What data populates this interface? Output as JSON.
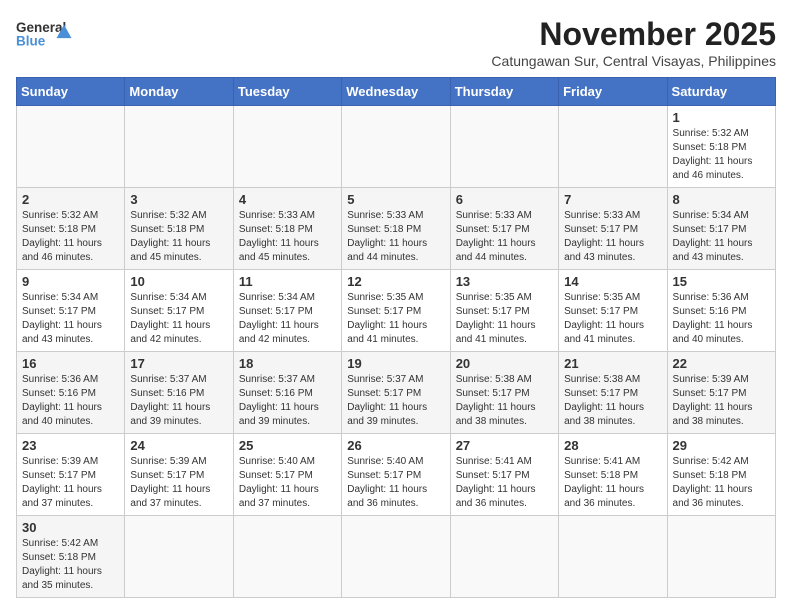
{
  "logo": {
    "general": "General",
    "blue": "Blue"
  },
  "header": {
    "month": "November 2025",
    "location": "Catungawan Sur, Central Visayas, Philippines"
  },
  "weekdays": [
    "Sunday",
    "Monday",
    "Tuesday",
    "Wednesday",
    "Thursday",
    "Friday",
    "Saturday"
  ],
  "weeks": [
    [
      {
        "day": "",
        "sunrise": "",
        "sunset": "",
        "daylight": ""
      },
      {
        "day": "",
        "sunrise": "",
        "sunset": "",
        "daylight": ""
      },
      {
        "day": "",
        "sunrise": "",
        "sunset": "",
        "daylight": ""
      },
      {
        "day": "",
        "sunrise": "",
        "sunset": "",
        "daylight": ""
      },
      {
        "day": "",
        "sunrise": "",
        "sunset": "",
        "daylight": ""
      },
      {
        "day": "",
        "sunrise": "",
        "sunset": "",
        "daylight": ""
      },
      {
        "day": "1",
        "sunrise": "Sunrise: 5:32 AM",
        "sunset": "Sunset: 5:18 PM",
        "daylight": "Daylight: 11 hours and 46 minutes."
      }
    ],
    [
      {
        "day": "2",
        "sunrise": "Sunrise: 5:32 AM",
        "sunset": "Sunset: 5:18 PM",
        "daylight": "Daylight: 11 hours and 46 minutes."
      },
      {
        "day": "3",
        "sunrise": "Sunrise: 5:32 AM",
        "sunset": "Sunset: 5:18 PM",
        "daylight": "Daylight: 11 hours and 45 minutes."
      },
      {
        "day": "4",
        "sunrise": "Sunrise: 5:33 AM",
        "sunset": "Sunset: 5:18 PM",
        "daylight": "Daylight: 11 hours and 45 minutes."
      },
      {
        "day": "5",
        "sunrise": "Sunrise: 5:33 AM",
        "sunset": "Sunset: 5:18 PM",
        "daylight": "Daylight: 11 hours and 44 minutes."
      },
      {
        "day": "6",
        "sunrise": "Sunrise: 5:33 AM",
        "sunset": "Sunset: 5:17 PM",
        "daylight": "Daylight: 11 hours and 44 minutes."
      },
      {
        "day": "7",
        "sunrise": "Sunrise: 5:33 AM",
        "sunset": "Sunset: 5:17 PM",
        "daylight": "Daylight: 11 hours and 43 minutes."
      },
      {
        "day": "8",
        "sunrise": "Sunrise: 5:34 AM",
        "sunset": "Sunset: 5:17 PM",
        "daylight": "Daylight: 11 hours and 43 minutes."
      }
    ],
    [
      {
        "day": "9",
        "sunrise": "Sunrise: 5:34 AM",
        "sunset": "Sunset: 5:17 PM",
        "daylight": "Daylight: 11 hours and 43 minutes."
      },
      {
        "day": "10",
        "sunrise": "Sunrise: 5:34 AM",
        "sunset": "Sunset: 5:17 PM",
        "daylight": "Daylight: 11 hours and 42 minutes."
      },
      {
        "day": "11",
        "sunrise": "Sunrise: 5:34 AM",
        "sunset": "Sunset: 5:17 PM",
        "daylight": "Daylight: 11 hours and 42 minutes."
      },
      {
        "day": "12",
        "sunrise": "Sunrise: 5:35 AM",
        "sunset": "Sunset: 5:17 PM",
        "daylight": "Daylight: 11 hours and 41 minutes."
      },
      {
        "day": "13",
        "sunrise": "Sunrise: 5:35 AM",
        "sunset": "Sunset: 5:17 PM",
        "daylight": "Daylight: 11 hours and 41 minutes."
      },
      {
        "day": "14",
        "sunrise": "Sunrise: 5:35 AM",
        "sunset": "Sunset: 5:17 PM",
        "daylight": "Daylight: 11 hours and 41 minutes."
      },
      {
        "day": "15",
        "sunrise": "Sunrise: 5:36 AM",
        "sunset": "Sunset: 5:16 PM",
        "daylight": "Daylight: 11 hours and 40 minutes."
      }
    ],
    [
      {
        "day": "16",
        "sunrise": "Sunrise: 5:36 AM",
        "sunset": "Sunset: 5:16 PM",
        "daylight": "Daylight: 11 hours and 40 minutes."
      },
      {
        "day": "17",
        "sunrise": "Sunrise: 5:37 AM",
        "sunset": "Sunset: 5:16 PM",
        "daylight": "Daylight: 11 hours and 39 minutes."
      },
      {
        "day": "18",
        "sunrise": "Sunrise: 5:37 AM",
        "sunset": "Sunset: 5:16 PM",
        "daylight": "Daylight: 11 hours and 39 minutes."
      },
      {
        "day": "19",
        "sunrise": "Sunrise: 5:37 AM",
        "sunset": "Sunset: 5:17 PM",
        "daylight": "Daylight: 11 hours and 39 minutes."
      },
      {
        "day": "20",
        "sunrise": "Sunrise: 5:38 AM",
        "sunset": "Sunset: 5:17 PM",
        "daylight": "Daylight: 11 hours and 38 minutes."
      },
      {
        "day": "21",
        "sunrise": "Sunrise: 5:38 AM",
        "sunset": "Sunset: 5:17 PM",
        "daylight": "Daylight: 11 hours and 38 minutes."
      },
      {
        "day": "22",
        "sunrise": "Sunrise: 5:39 AM",
        "sunset": "Sunset: 5:17 PM",
        "daylight": "Daylight: 11 hours and 38 minutes."
      }
    ],
    [
      {
        "day": "23",
        "sunrise": "Sunrise: 5:39 AM",
        "sunset": "Sunset: 5:17 PM",
        "daylight": "Daylight: 11 hours and 37 minutes."
      },
      {
        "day": "24",
        "sunrise": "Sunrise: 5:39 AM",
        "sunset": "Sunset: 5:17 PM",
        "daylight": "Daylight: 11 hours and 37 minutes."
      },
      {
        "day": "25",
        "sunrise": "Sunrise: 5:40 AM",
        "sunset": "Sunset: 5:17 PM",
        "daylight": "Daylight: 11 hours and 37 minutes."
      },
      {
        "day": "26",
        "sunrise": "Sunrise: 5:40 AM",
        "sunset": "Sunset: 5:17 PM",
        "daylight": "Daylight: 11 hours and 36 minutes."
      },
      {
        "day": "27",
        "sunrise": "Sunrise: 5:41 AM",
        "sunset": "Sunset: 5:17 PM",
        "daylight": "Daylight: 11 hours and 36 minutes."
      },
      {
        "day": "28",
        "sunrise": "Sunrise: 5:41 AM",
        "sunset": "Sunset: 5:18 PM",
        "daylight": "Daylight: 11 hours and 36 minutes."
      },
      {
        "day": "29",
        "sunrise": "Sunrise: 5:42 AM",
        "sunset": "Sunset: 5:18 PM",
        "daylight": "Daylight: 11 hours and 36 minutes."
      }
    ],
    [
      {
        "day": "30",
        "sunrise": "Sunrise: 5:42 AM",
        "sunset": "Sunset: 5:18 PM",
        "daylight": "Daylight: 11 hours and 35 minutes."
      },
      {
        "day": "",
        "sunrise": "",
        "sunset": "",
        "daylight": ""
      },
      {
        "day": "",
        "sunrise": "",
        "sunset": "",
        "daylight": ""
      },
      {
        "day": "",
        "sunrise": "",
        "sunset": "",
        "daylight": ""
      },
      {
        "day": "",
        "sunrise": "",
        "sunset": "",
        "daylight": ""
      },
      {
        "day": "",
        "sunrise": "",
        "sunset": "",
        "daylight": ""
      },
      {
        "day": "",
        "sunrise": "",
        "sunset": "",
        "daylight": ""
      }
    ]
  ]
}
